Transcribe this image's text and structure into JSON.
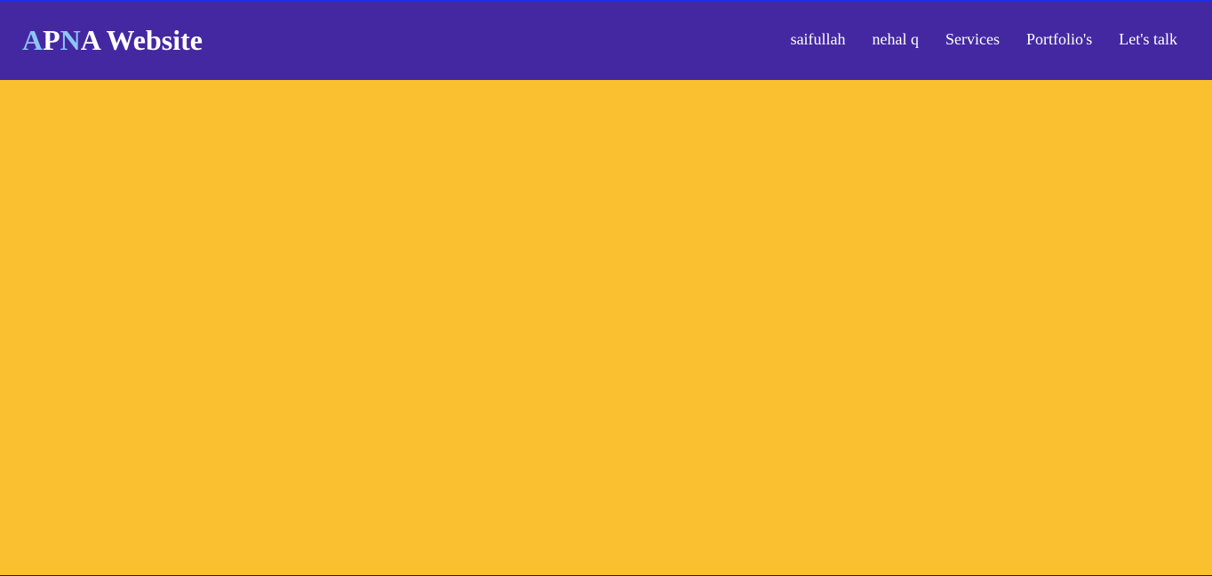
{
  "colors": {
    "nav_bg": "#4428a2",
    "page_bg": "#fac02f",
    "logo_accent": "#8ec5f5",
    "text": "#ffffff",
    "top_line": "#1d2bf5"
  },
  "logo": {
    "parts": [
      {
        "text": "A",
        "accent": true
      },
      {
        "text": "P",
        "accent": false
      },
      {
        "text": "N",
        "accent": true
      },
      {
        "text": "A Website",
        "accent": false
      }
    ]
  },
  "nav": {
    "items": [
      {
        "label": "saifullah"
      },
      {
        "label": "nehal q"
      },
      {
        "label": "Services"
      },
      {
        "label": "Portfolio's"
      },
      {
        "label": "Let's talk"
      }
    ]
  }
}
